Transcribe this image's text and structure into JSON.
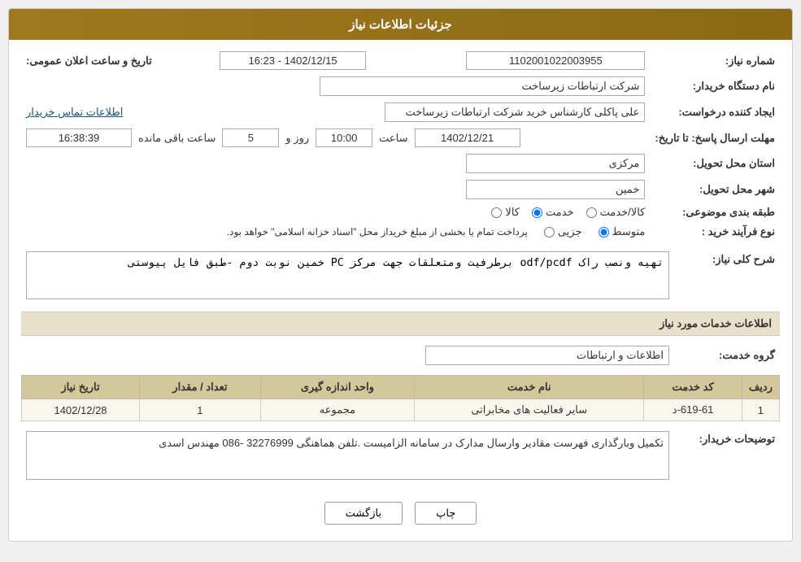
{
  "page": {
    "title": "جزئیات اطلاعات نیاز"
  },
  "header": {
    "title": "جزئیات اطلاعات نیاز"
  },
  "fields": {
    "need_number_label": "شماره نیاز:",
    "need_number_value": "1102001022003955",
    "announce_date_label": "تاریخ و ساعت اعلان عمومی:",
    "announce_date_value": "1402/12/15 - 16:23",
    "buyer_org_label": "نام دستگاه خریدار:",
    "buyer_org_value": "شرکت ارتباطات زیرساخت",
    "creator_label": "ایجاد کننده درخواست:",
    "creator_value": "علی پاکلی کارشناس خرید شرکت ارتباطات زیرساخت",
    "contact_link": "اطلاعات تماس خریدار",
    "reply_deadline_label": "مهلت ارسال پاسخ: تا تاریخ:",
    "reply_date": "1402/12/21",
    "reply_time_label": "ساعت",
    "reply_time": "10:00",
    "reply_days_label": "روز و",
    "reply_days": "5",
    "reply_remaining_label": "ساعت باقی مانده",
    "reply_remaining": "16:38:39",
    "province_label": "استان محل تحویل:",
    "province_value": "مرکزی",
    "city_label": "شهر محل تحویل:",
    "city_value": "خمین",
    "category_label": "طبقه بندی موضوعی:",
    "category_options": [
      "کالا",
      "خدمت",
      "کالا/خدمت"
    ],
    "category_selected": "خدمت",
    "purchase_type_label": "نوع فرآیند خرید :",
    "purchase_type_options": [
      "جزیی",
      "متوسط"
    ],
    "purchase_type_selected": "متوسط",
    "purchase_warning": "پرداخت تمام یا بخشی از مبلغ خریداز محل \"اسناد خزانه اسلامی\" خواهد بود.",
    "need_desc_label": "شرح کلی نیاز:",
    "need_desc_value": "تهیه ونصب راک odf/pcdf برطرفیت ومتعلقات جهت مرکز PC خمین نوبت دوم -طبق فایل پیوستی",
    "services_section_label": "اطلاعات خدمات مورد نیاز",
    "service_group_label": "گروه خدمت:",
    "service_group_value": "اطلاعات و ارتباطات",
    "table": {
      "headers": [
        "ردیف",
        "کد خدمت",
        "نام خدمت",
        "واحد اندازه گیری",
        "تعداد / مقدار",
        "تاریخ نیاز"
      ],
      "rows": [
        {
          "row": "1",
          "code": "619-61-د",
          "name": "سایر فعالیت های مخابراتی",
          "unit": "مجموعه",
          "quantity": "1",
          "date": "1402/12/28"
        }
      ]
    },
    "buyer_notes_label": "توضیحات خریدار:",
    "buyer_notes_value": "تکمیل وبارگذاری فهرست مقادیر وارسال مدارک در سامانه الزامیست .تلفن هماهنگی  32276999 -086  مهندس اسدی"
  },
  "buttons": {
    "print_label": "چاپ",
    "back_label": "بازگشت"
  }
}
